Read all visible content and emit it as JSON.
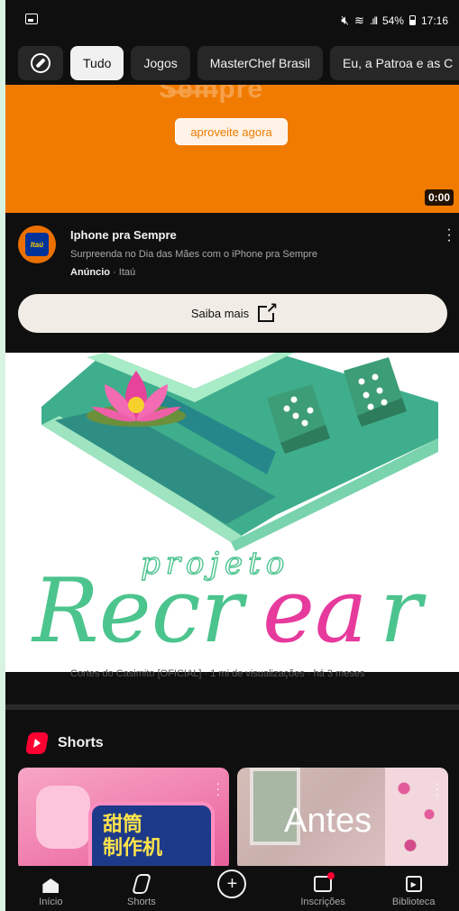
{
  "status_bar": {
    "battery": "54%",
    "time": "17:16"
  },
  "chips": [
    {
      "label": "Tudo",
      "active": true
    },
    {
      "label": "Jogos",
      "active": false
    },
    {
      "label": "MasterChef Brasil",
      "active": false
    },
    {
      "label": "Eu, a Patroa e as C",
      "active": false
    }
  ],
  "ad": {
    "video_faded_text": "Sempre",
    "video_cta": "aproveite agora",
    "duration": "0:00",
    "logo_text": "Itaú",
    "title": "Iphone pra Sempre",
    "description": "Surpreenda no Dia das Mães com o iPhone pra Sempre",
    "label": "Anúncio",
    "separator": "·",
    "advertiser": "Itaú",
    "button": "Saiba mais",
    "accent": "#f07b00"
  },
  "overlay_logo": {
    "small_text": "projeto",
    "big_text_green": "Recr",
    "big_text_pink": "ea",
    "big_text_end": "r"
  },
  "obscured_video_meta": "Cortes do Casimito [OFICIAL] · 1 mi de visualizações · há 3 meses",
  "shorts": {
    "title": "Shorts",
    "cards": [
      {
        "text": "甜筒\n制作机"
      },
      {
        "text": "Antes"
      }
    ]
  },
  "bottom_nav": [
    {
      "label": "Início"
    },
    {
      "label": "Shorts"
    },
    {
      "label": ""
    },
    {
      "label": "Inscrições"
    },
    {
      "label": "Biblioteca"
    }
  ]
}
